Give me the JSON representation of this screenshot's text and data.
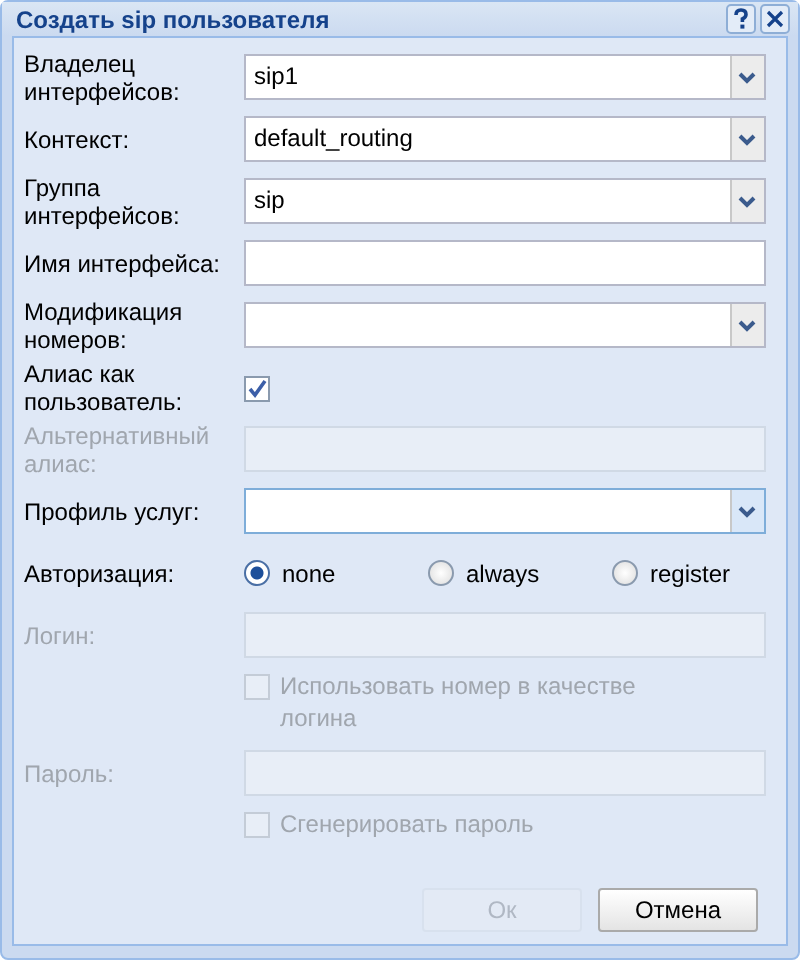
{
  "window": {
    "title": "Создать sip пользователя"
  },
  "fields": [
    {
      "kind": "select",
      "label": "Владелец интерфейсов:",
      "value": "sip1",
      "disabled": false,
      "focused": false
    },
    {
      "kind": "select",
      "label": "Контекст:",
      "value": "default_routing",
      "disabled": false,
      "focused": false
    },
    {
      "kind": "select",
      "label": "Группа интерфейсов:",
      "value": "sip",
      "disabled": false,
      "focused": false
    },
    {
      "kind": "text",
      "label": "Имя интерфейса:",
      "disabled": false
    },
    {
      "kind": "select",
      "label": "Модификация номеров:",
      "disabled": false,
      "focused": false
    },
    {
      "kind": "checkbox",
      "label": "Алиас как пользователь:",
      "checked": true,
      "disabled": false
    },
    {
      "kind": "text",
      "label": "Альтернативный алиас:",
      "disabled": true
    },
    {
      "kind": "select",
      "label": "Профиль услуг:",
      "disabled": false,
      "focused": true
    },
    {
      "kind": "radio",
      "label": "Авторизация:",
      "options": [
        {
          "label": "none",
          "selected": true
        },
        {
          "label": "always",
          "selected": false
        },
        {
          "label": "register",
          "selected": false
        }
      ]
    },
    {
      "kind": "text",
      "label": "Логин:",
      "disabled": true
    },
    {
      "kind": "checkbox",
      "option": "Использовать номер в качестве логина",
      "checked": false,
      "disabled": true
    },
    {
      "kind": "text",
      "label": "Пароль:",
      "disabled": true
    },
    {
      "kind": "checkbox",
      "option": "Сгенерировать пароль",
      "checked": false,
      "disabled": true
    }
  ],
  "buttons": [
    {
      "label": "Ок",
      "disabled": true
    },
    {
      "label": "Отмена",
      "disabled": false
    }
  ]
}
